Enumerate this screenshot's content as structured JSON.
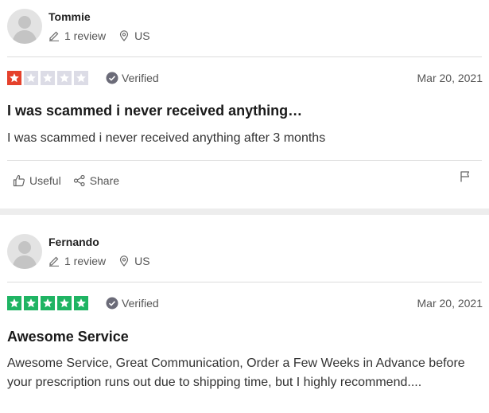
{
  "reviews": [
    {
      "reviewer": "Tommie",
      "review_count": "1 review",
      "country": "US",
      "rating": 1,
      "rating_color": "#e5412c",
      "verified_label": "Verified",
      "date": "Mar 20, 2021",
      "title": "I was scammed i never received anything…",
      "body": "I was scammed i never received anything after 3 months",
      "useful_label": "Useful",
      "share_label": "Share"
    },
    {
      "reviewer": "Fernando",
      "review_count": "1 review",
      "country": "US",
      "rating": 5,
      "rating_color": "#1fb463",
      "verified_label": "Verified",
      "date": "Mar 20, 2021",
      "title": "Awesome Service",
      "body": "Awesome Service, Great Communication, Order a Few Weeks in Advance before your prescription runs out due to shipping time, but I highly recommend...."
    }
  ],
  "icons": {
    "avatar": "avatar-placeholder-icon",
    "review_count": "pencil-icon",
    "location": "location-pin-icon",
    "verified": "check-circle-icon",
    "useful": "thumbs-up-icon",
    "share": "share-icon",
    "report": "flag-icon"
  },
  "colors": {
    "empty_star": "#dcdce6",
    "verified_badge": "#6b6b78",
    "band": "#ededed"
  }
}
